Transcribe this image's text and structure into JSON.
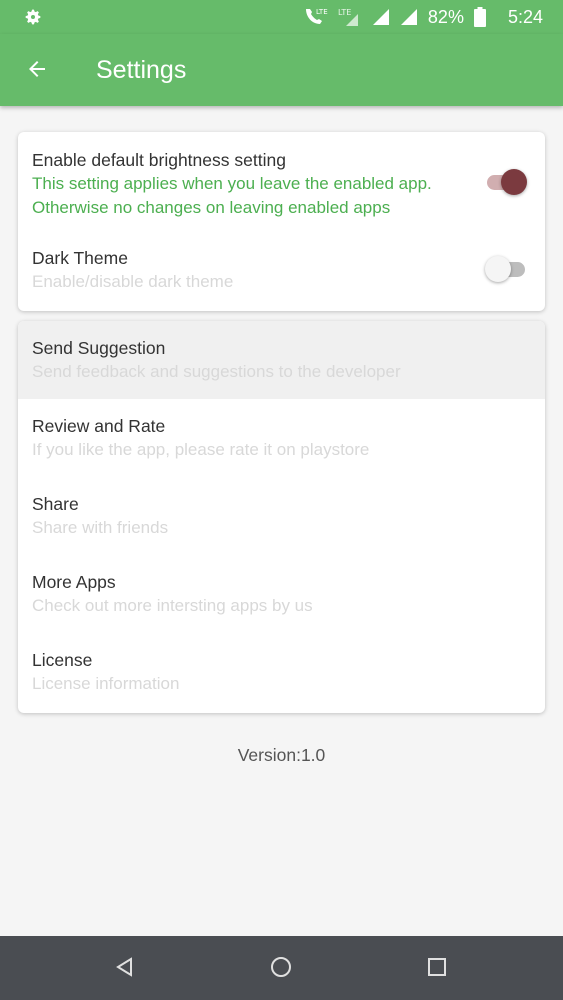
{
  "status_bar": {
    "battery_percent": "82%",
    "time": "5:24",
    "lte_label": "LTE",
    "icons": [
      "settings-gear-icon",
      "volte-call-icon",
      "lte-icon",
      "signal-icon",
      "battery-icon"
    ]
  },
  "app_bar": {
    "title": "Settings",
    "back_icon": "arrow-left-icon"
  },
  "settings_card": {
    "brightness": {
      "title": "Enable default brightness setting",
      "summary_line1": "This setting applies when you leave the enabled app.",
      "summary_line2": "Otherwise no changes on leaving enabled apps",
      "enabled": true
    },
    "dark_theme": {
      "title": "Dark Theme",
      "summary": "Enable/disable dark theme",
      "enabled": false
    }
  },
  "links_card": {
    "items": [
      {
        "title": "Send Suggestion",
        "summary": "Send feedback and suggestions to the developer"
      },
      {
        "title": "Review and Rate",
        "summary": "If you like the app, please rate it on playstore"
      },
      {
        "title": "Share",
        "summary": "Share with friends"
      },
      {
        "title": "More Apps",
        "summary": "Check out more intersting apps by us"
      },
      {
        "title": "License",
        "summary": "License information"
      }
    ]
  },
  "version_text": "Version:1.0",
  "colors": {
    "primary": "#66bb6a",
    "summary_green": "#4caf50",
    "switch_thumb_on": "#7b3a3f",
    "navbar": "#4a4d52"
  },
  "nav_bar": {
    "icons": [
      "back-triangle-icon",
      "home-circle-icon",
      "recents-square-icon"
    ]
  }
}
